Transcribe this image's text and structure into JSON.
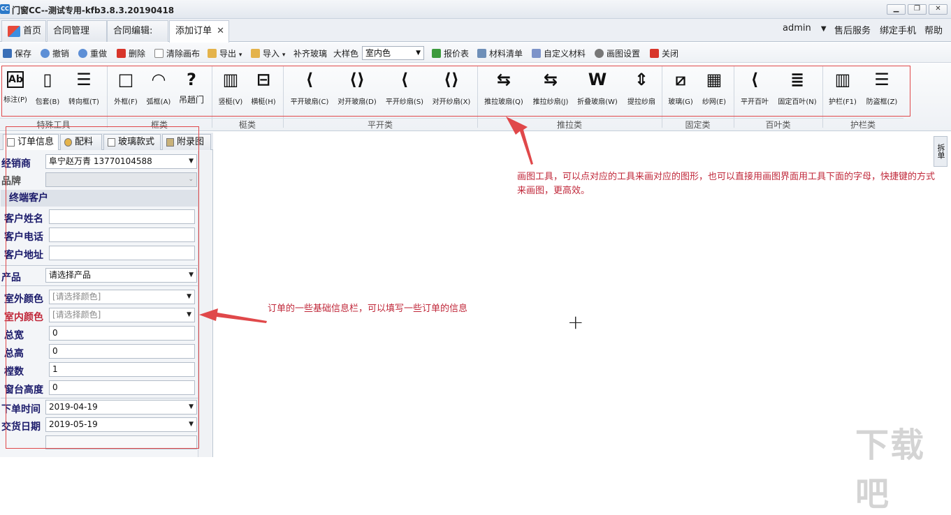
{
  "window": {
    "app_icon_text": "CC",
    "title": "门窗CC--测试专用-kfb3.8.3.20190418",
    "min": "▁",
    "restore": "❐",
    "close": "✕"
  },
  "tabs": [
    {
      "label": "首页"
    },
    {
      "label": "合同管理"
    },
    {
      "label": "合同编辑:"
    },
    {
      "label": "添加订单",
      "close": "✕"
    }
  ],
  "top_right": {
    "user": "admin",
    "user_arrow": "▼",
    "after_sale": "售后服务",
    "bind_phone": "绑定手机",
    "help": "帮助"
  },
  "toolbar": {
    "save": "保存",
    "undo": "撤销",
    "redo": "重做",
    "delete": "删除",
    "clear_canvas": "清除画布",
    "export": "导出",
    "export_arrow": "▾",
    "import": "导入",
    "import_arrow": "▾",
    "fill_glass": "补齐玻璃",
    "sample_label": "大样色",
    "sample_value": "室内色",
    "sample_arrow": "▼",
    "quote": "报价表",
    "material_list": "材料清单",
    "custom_material": "自定义材料",
    "draw_settings": "画图设置",
    "close": "关闭"
  },
  "ribbon": {
    "buttons": [
      {
        "glyph": "Ab",
        "label": "标注(P)"
      },
      {
        "glyph": "▯",
        "label": "包套(B)"
      },
      {
        "glyph": "☰",
        "label": "转向框(T)"
      },
      {
        "glyph": "□",
        "label": "外框(F)"
      },
      {
        "glyph": "◠",
        "label": "弧框(A)"
      },
      {
        "glyph": "?",
        "label": "吊趟门"
      },
      {
        "glyph": "▥",
        "label": "竖梃(V)"
      },
      {
        "glyph": "⊟",
        "label": "横梃(H)"
      },
      {
        "glyph": "⟨",
        "label": "平开玻扇(C)"
      },
      {
        "glyph": "⟨⟩",
        "label": "对开玻扇(D)"
      },
      {
        "glyph": "⟨",
        "label": "平开纱扇(S)"
      },
      {
        "glyph": "⟨⟩",
        "label": "对开纱扇(X)"
      },
      {
        "glyph": "⇆",
        "label": "推拉玻扇(Q)"
      },
      {
        "glyph": "⇆",
        "label": "推拉纱扇(J)"
      },
      {
        "glyph": "W",
        "label": "折叠玻扇(W)"
      },
      {
        "glyph": "⇕",
        "label": "提拉纱扇"
      },
      {
        "glyph": "⧄",
        "label": "玻璃(G)"
      },
      {
        "glyph": "▦",
        "label": "纱网(E)"
      },
      {
        "glyph": "⟨",
        "label": "平开百叶"
      },
      {
        "glyph": "≣",
        "label": "固定百叶(N)"
      },
      {
        "glyph": "▥",
        "label": "护栏(F1)"
      },
      {
        "glyph": "☰",
        "label": "防盗框(Z)"
      }
    ],
    "groups": [
      "特殊工具",
      "框类",
      "梃类",
      "平开类",
      "推拉类",
      "固定类",
      "百叶类",
      "护栏类"
    ]
  },
  "panel": {
    "tabs": [
      {
        "label": "订单信息"
      },
      {
        "label": "配料"
      },
      {
        "label": "玻璃款式"
      },
      {
        "label": "附录图"
      }
    ],
    "dealer_label": "经销商",
    "dealer_value": "阜宁赵万青 13770104588",
    "arrow": "▼",
    "brand_label": "品牌",
    "brand_arrow": "⌄",
    "end_customer": "终端客户",
    "cust_name_label": "客户姓名",
    "cust_phone_label": "客户电话",
    "cust_addr_label": "客户地址",
    "product_label": "产品",
    "product_value": "请选择产品",
    "outer_color_label": "室外颜色",
    "outer_color_ph": "[请选择颜色]",
    "inner_color_label": "室内颜色",
    "inner_color_ph": "[请选择颜色]",
    "width_label": "总宽",
    "width_value": "0",
    "height_label": "总高",
    "height_value": "0",
    "count_label": "樘数",
    "count_value": "1",
    "sill_label": "窗台高度",
    "sill_value": "0",
    "order_time_label": "下单时间",
    "order_time_value": "2019-04-19",
    "delivery_label": "交货日期",
    "delivery_value": "2019-05-19"
  },
  "side_tab": "拆单",
  "annotations": {
    "draw_tools": "画图工具，可以点对应的工具来画对应的图形，也可以直接用画图界面用工具下面的字母，快捷键的方式来画图，更高效。",
    "order_info": "订单的一些基础信息栏，可以填写一些订单的信息"
  },
  "cursor": "+",
  "watermark": "下载吧",
  "colors": {
    "annotation": "#c0283a",
    "label": "#1a1a6a",
    "accent": "#2b79c9"
  }
}
